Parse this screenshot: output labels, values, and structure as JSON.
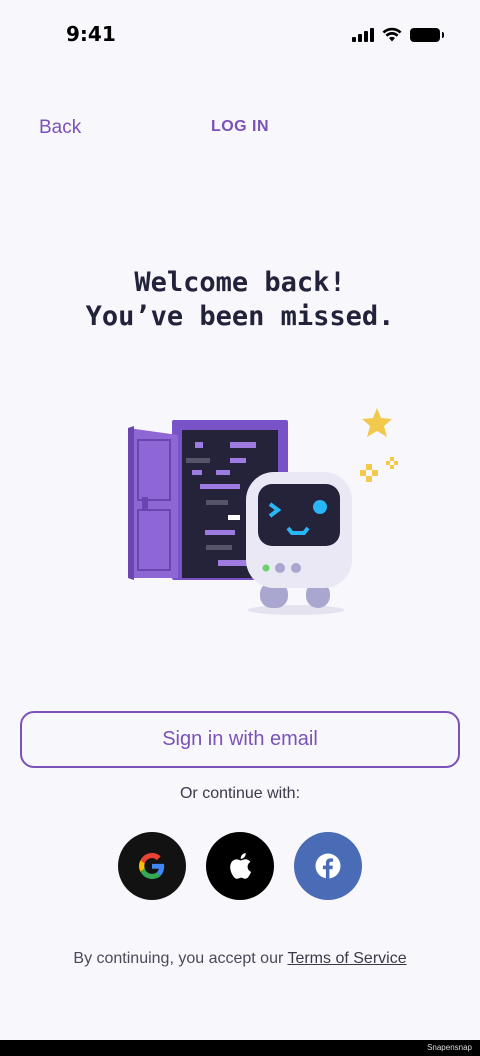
{
  "status_bar": {
    "time": "9:41"
  },
  "nav": {
    "back_label": "Back",
    "title": "LOG IN"
  },
  "headline": {
    "line1": "Welcome back!",
    "line2": "You’ve been missed."
  },
  "illustration": {
    "name": "robot-open-door-illustration"
  },
  "actions": {
    "email_button_label": "Sign in with email",
    "continue_text": "Or continue with:"
  },
  "social": [
    {
      "name": "google",
      "icon": "google-icon",
      "color": "#121212"
    },
    {
      "name": "apple",
      "icon": "apple-icon",
      "color": "#000000"
    },
    {
      "name": "facebook",
      "icon": "facebook-icon",
      "color": "#4A6BB5"
    }
  ],
  "terms": {
    "prefix": "By continuing, you accept our ",
    "link_label": "Terms of Service"
  },
  "watermark": "Snapensnap",
  "colors": {
    "accent": "#7A52B8",
    "background": "#F8F7FC"
  }
}
